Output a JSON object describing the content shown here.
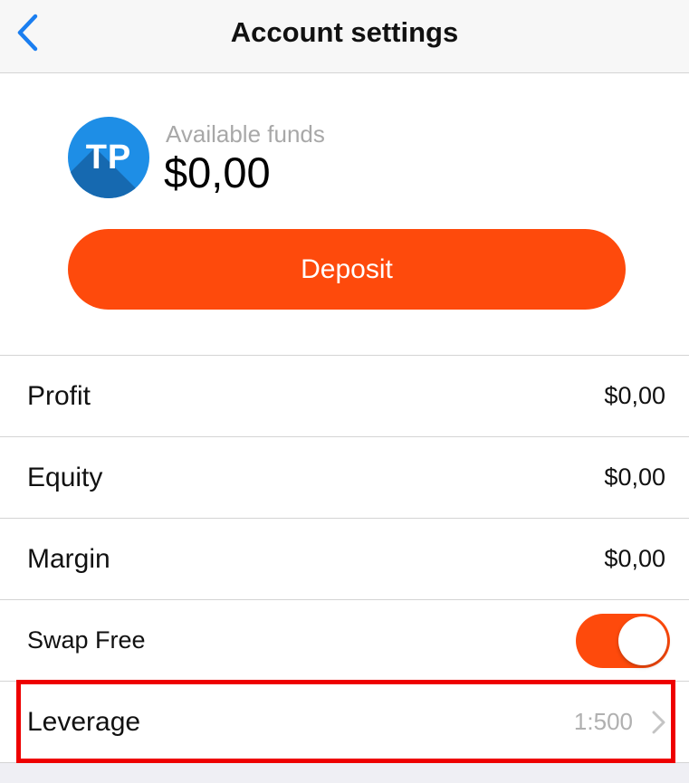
{
  "nav": {
    "title": "Account settings",
    "back_icon": "chevron-left-icon"
  },
  "account": {
    "avatar_initials": "TP",
    "funds_label": "Available funds",
    "funds_value": "$0,00",
    "deposit_label": "Deposit"
  },
  "rows": [
    {
      "label": "Profit",
      "value": "$0,00"
    },
    {
      "label": "Equity",
      "value": "$0,00"
    },
    {
      "label": "Margin",
      "value": "$0,00"
    }
  ],
  "swap_free": {
    "label": "Swap Free",
    "enabled": true
  },
  "leverage": {
    "label": "Leverage",
    "value": "1:500"
  },
  "colors": {
    "accent": "#fe4a0c",
    "nav_blue": "#1a7ef0",
    "avatar_blue": "#1e8ee6",
    "highlight": "#ee0000"
  }
}
